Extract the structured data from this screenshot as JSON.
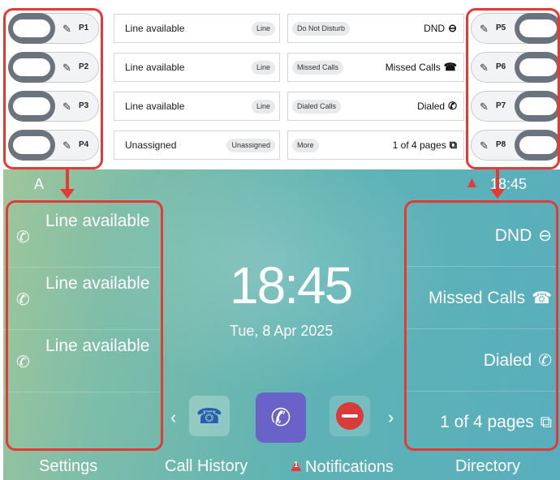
{
  "left_keys": [
    {
      "pnum": "P1",
      "label": "Line available",
      "tag": "Line"
    },
    {
      "pnum": "P2",
      "label": "Line available",
      "tag": "Line"
    },
    {
      "pnum": "P3",
      "label": "Line available",
      "tag": "Line"
    },
    {
      "pnum": "P4",
      "label": "Unassigned",
      "tag": "Unassigned"
    }
  ],
  "right_keys": [
    {
      "pnum": "P5",
      "tag": "Do Not Disturb",
      "value": "DND",
      "icon": "dnd-icon"
    },
    {
      "pnum": "P6",
      "tag": "Missed Calls",
      "value": "Missed Calls",
      "icon": "missed-call-icon"
    },
    {
      "pnum": "P7",
      "tag": "Dialed Calls",
      "value": "Dialed",
      "icon": "dialed-call-icon"
    },
    {
      "pnum": "P8",
      "tag": "More",
      "value": "1 of 4 pages",
      "icon": "pages-icon"
    }
  ],
  "screen": {
    "account": "A",
    "status_time": "18:45",
    "clock": "18:45",
    "date": "Tue, 8 Apr 2025",
    "left_lines": [
      "Line available",
      "Line available",
      "Line available"
    ],
    "right_items": [
      {
        "label": "DND",
        "icon": "dnd-icon"
      },
      {
        "label": "Missed Calls",
        "icon": "missed-call-icon"
      },
      {
        "label": "Dialed",
        "icon": "dialed-call-icon"
      },
      {
        "label": "1 of 4 pages",
        "icon": "pages-icon"
      }
    ],
    "softkeys": [
      "Settings",
      "Call History",
      "Notifications",
      "Directory"
    ],
    "notification_count": "1"
  },
  "colors": {
    "highlight": "#e53935",
    "toggle": "#6b747c",
    "warning": "#e53935"
  }
}
